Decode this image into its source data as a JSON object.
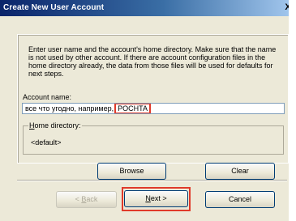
{
  "window": {
    "title": "Create New User Account",
    "close_glyph": "X"
  },
  "description": "Enter user name and the account's home directory. Make sure that the name\nis not used by other account. If there are account configuration files in the\nhome directory already, the data from those files will be used for defaults for\nnext steps.",
  "account": {
    "label": "Account name:",
    "value_prefix": "все что угодно, например,",
    "value_highlight": "POCHTA"
  },
  "home": {
    "legend_accel": "H",
    "legend_rest": "ome directory:",
    "value": "<default>"
  },
  "buttons": {
    "browse": "Browse",
    "clear": "Clear",
    "back_prefix": "< ",
    "back_accel": "B",
    "back_rest": "ack",
    "next_accel": "N",
    "next_rest": "ext >",
    "cancel": "Cancel"
  },
  "colors": {
    "highlight_box": "#e03a2a",
    "title_gradient_start": "#0a246a",
    "title_gradient_end": "#a6caf0"
  },
  "icons": {
    "close": "close-icon"
  }
}
